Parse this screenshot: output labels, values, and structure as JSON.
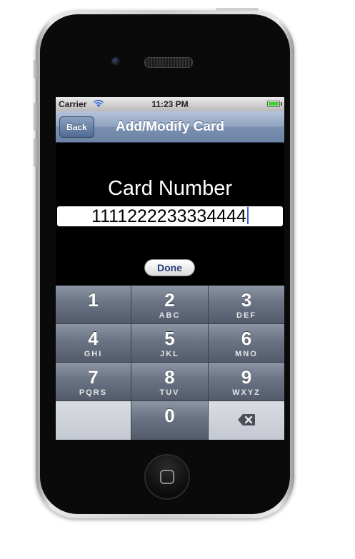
{
  "status_bar": {
    "carrier": "Carrier",
    "time": "11:23 PM",
    "icons": [
      "wifi-icon",
      "battery-icon"
    ]
  },
  "navbar": {
    "back_label": "Back",
    "title": "Add/Modify Card"
  },
  "form": {
    "field_label": "Card Number",
    "field_value": "1111222233334444",
    "done_label": "Done"
  },
  "keypad": {
    "keys": [
      {
        "digit": "1",
        "letters": ""
      },
      {
        "digit": "2",
        "letters": "ABC"
      },
      {
        "digit": "3",
        "letters": "DEF"
      },
      {
        "digit": "4",
        "letters": "GHI"
      },
      {
        "digit": "5",
        "letters": "JKL"
      },
      {
        "digit": "6",
        "letters": "MNO"
      },
      {
        "digit": "7",
        "letters": "PQRS"
      },
      {
        "digit": "8",
        "letters": "TUV"
      },
      {
        "digit": "9",
        "letters": "WXYZ"
      },
      {
        "digit": "",
        "letters": ""
      },
      {
        "digit": "0",
        "letters": ""
      }
    ],
    "delete_icon": "backspace-icon"
  },
  "colors": {
    "navbar": "#7a90b0",
    "done_text": "#2a3f77",
    "battery": "#3bd032",
    "caret": "#3864d8"
  }
}
